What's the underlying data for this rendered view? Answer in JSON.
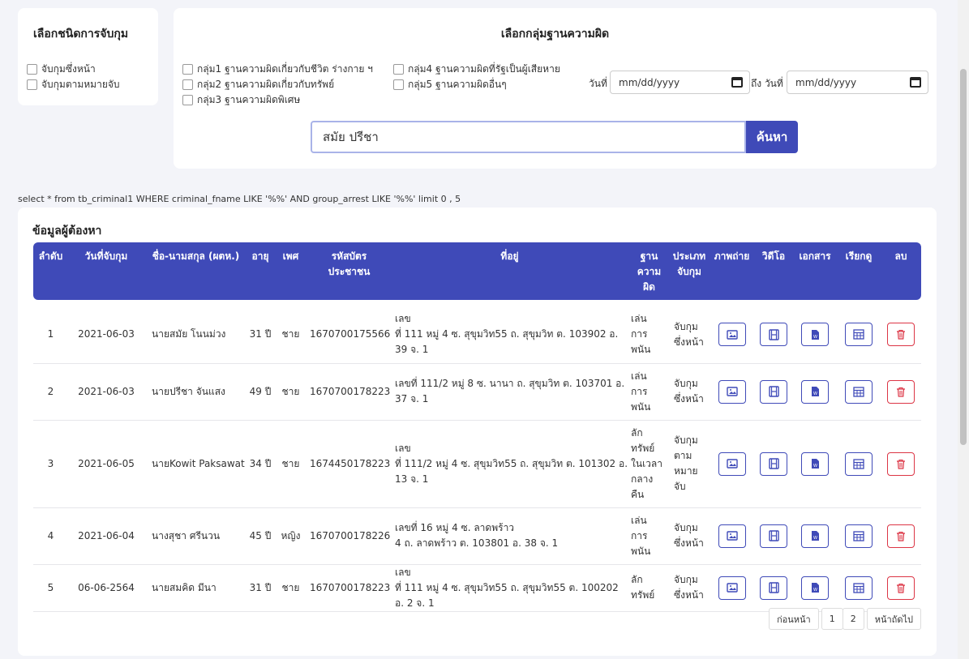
{
  "arrest_type": {
    "title": "เลือกชนิดการจับกุม",
    "options": [
      "จับกุมซึ่งหน้า",
      "จับกุมตามหมายจับ"
    ]
  },
  "fault_group": {
    "title": "เลือกกลุ่มฐานความผิด",
    "options": [
      "กลุ่ม1 ฐานความผิดเกี่ยวกับชีวิต ร่างกาย ฯ",
      "กลุ่ม2 ฐานความผิดเกี่ยวกับทรัพย์",
      "กลุ่ม3 ฐานความผิดพิเศษ",
      "กลุ่ม4 ฐานความผิดที่รัฐเป็นผู้เสียหาย",
      "กลุ่ม5 ฐานความผิดอื่นๆ"
    ],
    "date_from_label": "วันที่",
    "date_to_label": "ถึง วันที่",
    "date_from_value": "mm/dd/yyyy",
    "date_to_value": "mm/dd/yyyy"
  },
  "search": {
    "value": "สมัย ปรีชา",
    "button_label": "ค้นหา"
  },
  "sql_query": "select * from tb_criminal1 WHERE criminal_fname LIKE '%%' AND group_arrest LIKE '%%' limit 0 , 5",
  "table": {
    "title": "ข้อมูลผู้ต้องหา",
    "headers": {
      "no": "ลำดับ",
      "date": "วันที่จับกุม",
      "name": "ชื่อ-นามสกุล (ผตห.)",
      "age": "อายุ",
      "sex": "เพศ",
      "id_card": "รหัสบัตรประชาชน",
      "address": "ที่อยู่",
      "fault": "ฐานความผิด",
      "arrest_type": "ประเภทจับกุม",
      "photo": "ภาพถ่าย",
      "video": "วิดีโอ",
      "document": "เอกสาร",
      "summon": "เรียกดู",
      "delete": "ลบ"
    },
    "rows": [
      {
        "no": "1",
        "date": "2021-06-03",
        "name": "นายสมัย โนนม่วง",
        "age": "31 ปี",
        "sex": "ชาย",
        "id_card": "1670700175566",
        "address": "เลข\nที่ 111 หมู่ 4 ซ. สุขุมวิท55 ถ. สุขุมวิท ต. 103902 อ. 39 จ. 1",
        "fault": "เล่น\nการ\nพนัน",
        "arrest_type": "จับกุม\nซึ่งหน้า"
      },
      {
        "no": "2",
        "date": "2021-06-03",
        "name": "นายปรีชา จันแสง",
        "age": "49 ปี",
        "sex": "ชาย",
        "id_card": "1670700178223",
        "address": "เลขที่ 111/2 หมู่ 8 ซ. นานา ถ. สุขุมวิท ต. 103701 อ. 37 จ. 1",
        "fault": "เล่น\nการ\nพนัน",
        "arrest_type": "จับกุม\nซึ่งหน้า"
      },
      {
        "no": "3",
        "date": "2021-06-05",
        "name": "นายKowit Paksawat",
        "age": "34 ปี",
        "sex": "ชาย",
        "id_card": "1674450178223",
        "address": "เลข\nที่ 111/2 หมู่ 4 ซ. สุขุมวิท55 ถ. สุขุมวิท ต. 101302 อ. 13 จ. 1",
        "fault": "ลัก\nทรัพย์\nในเวลา\nกลาง\nคืน",
        "arrest_type": "จับกุม\nตาม\nหมาย\nจับ"
      },
      {
        "no": "4",
        "date": "2021-06-04",
        "name": "นางสุชา ศรีนวน",
        "age": "45 ปี",
        "sex": "หญิง",
        "id_card": "1670700178226",
        "address": "เลขที่ 16 หมู่ 4 ซ. ลาดพร้าว\n4 ถ. ลาดพร้าว ต. 103801 อ. 38 จ. 1",
        "fault": "เล่น\nการ\nพนัน",
        "arrest_type": "จับกุม\nซึ่งหน้า"
      },
      {
        "no": "5",
        "date": "06-06-2564",
        "name": "นายสมคิด มีนา",
        "age": "31 ปี",
        "sex": "ชาย",
        "id_card": "1670700178223",
        "address": "เลข\nที่ 111 หมู่ 4 ซ. สุขุมวิท55 ถ. สุขุมวิท55 ต. 100202 อ. 2 จ. 1",
        "fault": "ลัก\nทรัพย์",
        "arrest_type": "จับกุม\nซึ่งหน้า"
      }
    ],
    "row_icons": [
      "image-icon",
      "film-icon",
      "word-document-icon",
      "table-icon",
      "trash-icon"
    ]
  },
  "pagination": {
    "prev_label": "ก่อนหน้า",
    "pages": [
      "1",
      "2"
    ],
    "next_label": "หน้าถัดไป"
  },
  "colors": {
    "primary": "#3f4ab8",
    "danger": "#dc3545",
    "background": "#f3f4f9"
  }
}
